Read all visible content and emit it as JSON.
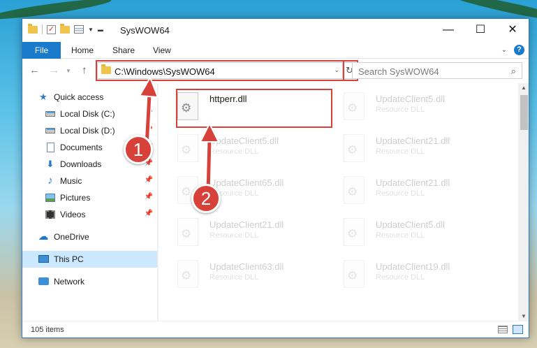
{
  "window": {
    "title": "SysWOW64",
    "controls": {
      "minimize": "—",
      "maximize": "☐",
      "close": "✕"
    }
  },
  "ribbon": {
    "tabs": [
      "File",
      "Home",
      "Share",
      "View"
    ],
    "help": "?"
  },
  "navigation": {
    "address": "C:\\Windows\\SysWOW64",
    "search_placeholder": "Search SysWOW64"
  },
  "sidebar": {
    "items": [
      {
        "label": "Quick access",
        "icon": "star-icon",
        "pinned": false
      },
      {
        "label": "Local Disk (C:)",
        "icon": "drive-icon",
        "pinned": true
      },
      {
        "label": "Local Disk (D:)",
        "icon": "drive-icon",
        "pinned": true
      },
      {
        "label": "Documents",
        "icon": "documents-icon",
        "pinned": true
      },
      {
        "label": "Downloads",
        "icon": "download-arrow-icon",
        "pinned": true
      },
      {
        "label": "Music",
        "icon": "music-note-icon",
        "pinned": true
      },
      {
        "label": "Pictures",
        "icon": "pictures-icon",
        "pinned": true
      },
      {
        "label": "Videos",
        "icon": "videos-icon",
        "pinned": true
      },
      {
        "label": "OneDrive",
        "icon": "cloud-icon",
        "pinned": false
      },
      {
        "label": "This PC",
        "icon": "computer-icon",
        "pinned": false,
        "selected": true
      },
      {
        "label": "Network",
        "icon": "network-icon",
        "pinned": false
      }
    ]
  },
  "files": [
    {
      "name": "httperr.dll",
      "type": "",
      "highlighted": true
    },
    {
      "name": "UpdateClient5.dll",
      "type": "Resource DLL"
    },
    {
      "name": "UpdateClient5.dll",
      "type": "Resource DLL"
    },
    {
      "name": "UpdateClient21.dll",
      "type": "Resource DLL"
    },
    {
      "name": "UpdateClient65.dll",
      "type": "Resource DLL"
    },
    {
      "name": "UpdateClient21.dll",
      "type": "Resource DLL"
    },
    {
      "name": "UpdateClient21.dll",
      "type": "Resource DLL"
    },
    {
      "name": "UpdateClient5.dll",
      "type": "Resource DLL"
    },
    {
      "name": "UpdateClient63.dll",
      "type": "Resource DLL"
    },
    {
      "name": "UpdateClient19.dll",
      "type": "Resource DLL"
    }
  ],
  "status": {
    "items_count": "105 items"
  },
  "callouts": {
    "first": "1",
    "second": "2"
  },
  "colors": {
    "accent": "#1979ca",
    "callout_red": "#d8413a",
    "selection": "#cce8ff"
  }
}
